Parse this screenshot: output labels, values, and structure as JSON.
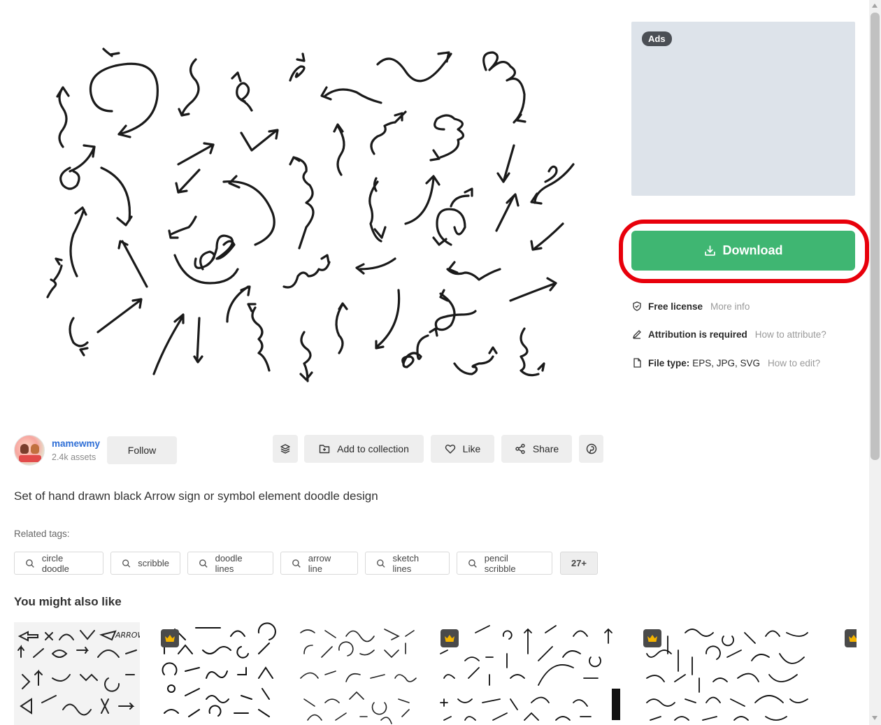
{
  "ads": {
    "badge": "Ads"
  },
  "download": {
    "label": "Download",
    "icon": "download-icon"
  },
  "info": {
    "license": {
      "label": "Free license",
      "link": "More info",
      "icon": "shield-icon"
    },
    "attribution": {
      "label": "Attribution is required",
      "link": "How to attribute?",
      "icon": "pen-icon"
    },
    "filetype": {
      "label": "File type:",
      "value": "EPS, JPG, SVG",
      "link": "How to edit?",
      "icon": "file-icon"
    }
  },
  "author": {
    "name": "mamewmy",
    "assets": "2.4k assets",
    "follow": "Follow"
  },
  "actions": {
    "collection": "Add to collection",
    "like": "Like",
    "share": "Share"
  },
  "title": "Set of hand drawn black Arrow sign or symbol element doodle design",
  "related": {
    "label": "Related tags:",
    "tags": [
      "circle doodle",
      "scribble",
      "doodle lines",
      "arrow line",
      "sketch lines",
      "pencil scribble"
    ],
    "more": "27+"
  },
  "also_like": {
    "title": "You might also like",
    "thumb_text": "ARROW"
  },
  "colors": {
    "download": "#3fb672",
    "highlight": "#e8000b",
    "author": "#2f6fd6",
    "ads_bg": "#dde3ea"
  }
}
